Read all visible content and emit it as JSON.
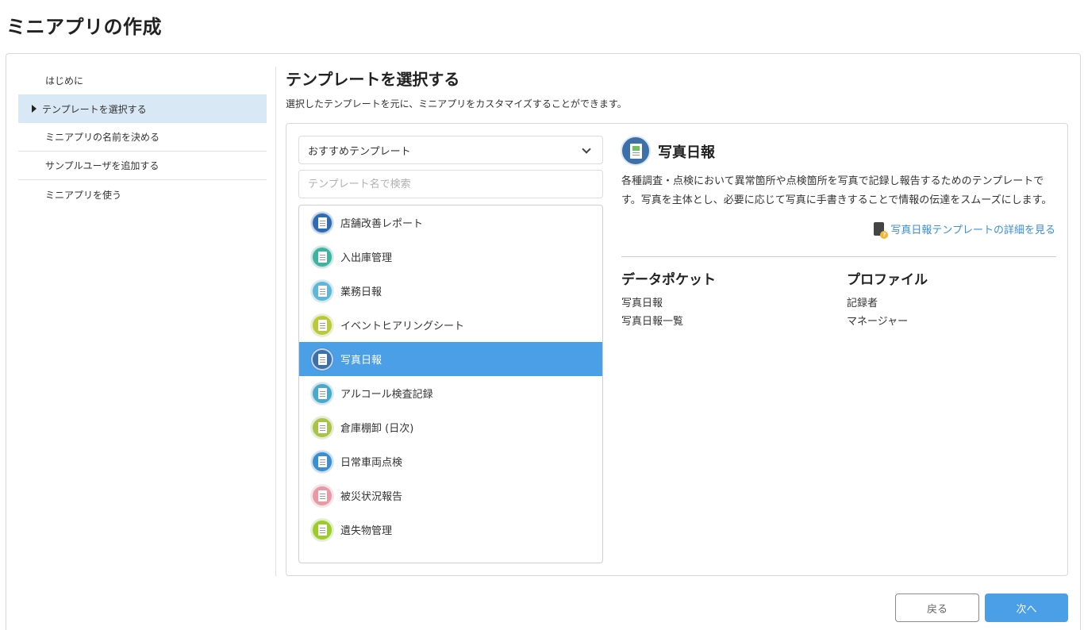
{
  "page_title": "ミニアプリの作成",
  "steps": [
    {
      "label": "はじめに"
    },
    {
      "label": "テンプレートを選択する",
      "active": true
    },
    {
      "label": "ミニアプリの名前を決める"
    },
    {
      "label": "サンプルユーザを追加する"
    },
    {
      "label": "ミニアプリを使う"
    }
  ],
  "section": {
    "title": "テンプレートを選択する",
    "description": "選択したテンプレートを元に、ミニアプリをカスタマイズすることができます。"
  },
  "filter": {
    "selected": "おすすめテンプレート",
    "search_placeholder": "テンプレート名で検索"
  },
  "templates": [
    {
      "label": "店舗改善レポート",
      "icon": "report-icon",
      "color": "#2f6bb0"
    },
    {
      "label": "入出庫管理",
      "icon": "inventory-icon",
      "color": "#3fb3a0"
    },
    {
      "label": "業務日報",
      "icon": "building-icon",
      "color": "#5fb6d6"
    },
    {
      "label": "イベントヒアリングシート",
      "icon": "clipboard-icon",
      "color": "#b9c93a"
    },
    {
      "label": "写真日報",
      "icon": "photo-report-icon",
      "color": "#3d6fa8",
      "selected": true
    },
    {
      "label": "アルコール検査記録",
      "icon": "alcohol-icon",
      "color": "#4aa9c9"
    },
    {
      "label": "倉庫棚卸 (日次)",
      "icon": "warehouse-icon",
      "color": "#a8c24a"
    },
    {
      "label": "日常車両点検",
      "icon": "truck-icon",
      "color": "#3c8fcf"
    },
    {
      "label": "被災状況報告",
      "icon": "disaster-icon",
      "color": "#e79aa6"
    },
    {
      "label": "遺失物管理",
      "icon": "umbrella-icon",
      "color": "#9ccc2c"
    }
  ],
  "detail": {
    "title": "写真日報",
    "description": "各種調査・点検において異常箇所や点検箇所を写真で記録し報告するためのテンプレートです。写真を主体とし、必要に応じて写真に手書きすることで情報の伝達をスムーズにします。",
    "link": "写真日報テンプレートの詳細を見る",
    "data_pockets_heading": "データポケット",
    "data_pockets": [
      "写真日報",
      "写真日報一覧"
    ],
    "profile_heading": "プロファイル",
    "profiles": [
      "記録者",
      "マネージャー"
    ]
  },
  "buttons": {
    "back": "戻る",
    "next": "次へ"
  }
}
